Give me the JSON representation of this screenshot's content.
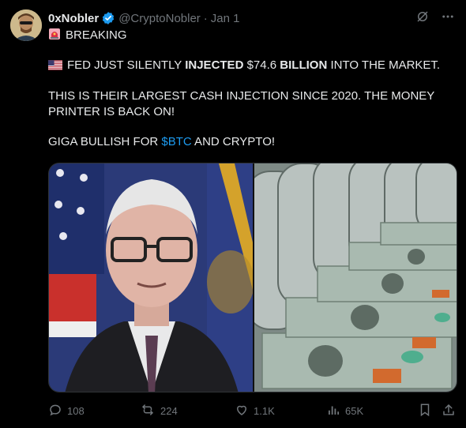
{
  "author": {
    "name": "0xNobler",
    "handle": "@CryptoNobler",
    "separator": "·",
    "date": "Jan 1"
  },
  "tweet": {
    "line1_label": "BREAKING",
    "line2_part1": "FED JUST SILENTLY ",
    "line2_bold1": "INJECTED",
    "line2_part2": " $74",
    "line2_part3": ".6 ",
    "line2_bold2": "BILLION",
    "line2_part4": " INTO THE MARKET.",
    "line3": "THIS IS THEIR LARGEST CASH INJECTION SINCE 2020. THE MONEY",
    "line4": "PRINTER IS BACK ON!",
    "line5_part1": "GIGA BULLISH FOR ",
    "line5_cashtag": "$BTC",
    "line5_part2": " AND CRYPTO!"
  },
  "media": {
    "left_image": "fed-chair-portrait",
    "right_image": "printed-dollar-bills"
  },
  "actions": {
    "replies": "108",
    "reposts": "224",
    "likes": "1.1K",
    "views": "65K"
  },
  "colors": {
    "background": "#000000",
    "text": "#e7e9ea",
    "muted": "#71767b",
    "accent": "#1d9bf0"
  },
  "icons": [
    "siren-icon",
    "us-flag-icon",
    "verified-badge-icon",
    "grok-icon",
    "more-icon",
    "reply-icon",
    "repost-icon",
    "like-icon",
    "views-icon",
    "bookmark-icon",
    "share-icon"
  ]
}
